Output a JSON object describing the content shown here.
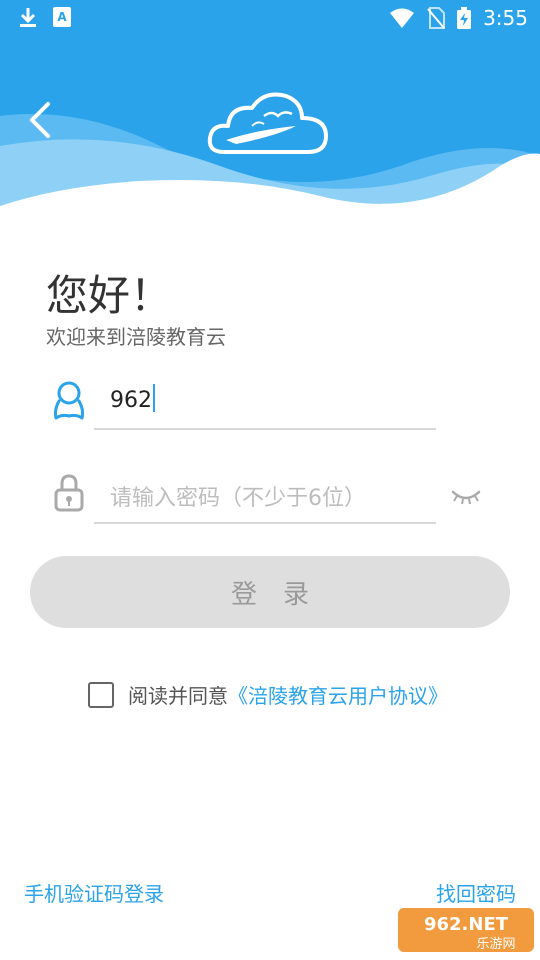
{
  "status_bar": {
    "time": "3:55",
    "left_icons": [
      "download-icon",
      "a11y-icon"
    ],
    "right_icons": [
      "wifi-icon",
      "no-sim-icon",
      "battery-charging-icon"
    ]
  },
  "header": {
    "back_icon": "chevron-left-icon",
    "logo_icon": "cloud-logo-icon",
    "bg_color": "#2aa3ea"
  },
  "greeting": {
    "title": "您好！",
    "subtitle": "欢迎来到涪陵教育云"
  },
  "username_field": {
    "icon": "user-icon",
    "value": "962"
  },
  "password_field": {
    "icon": "lock-icon",
    "placeholder": "请输入密码（不少于6位）",
    "toggle_icon": "eye-closed-icon"
  },
  "login_button": {
    "label": "登　录"
  },
  "agreement": {
    "text": "阅读并同意",
    "link": "《涪陵教育云用户协议》"
  },
  "footer": {
    "sms_login": "手机验证码登录",
    "find_password": "找回密码"
  },
  "watermark": {
    "text_top": "962.NET",
    "text_bottom": "乐游网"
  },
  "colors": {
    "accent": "#2aa3ea",
    "button_bg": "#dedede",
    "button_text": "#9a9a9a"
  }
}
